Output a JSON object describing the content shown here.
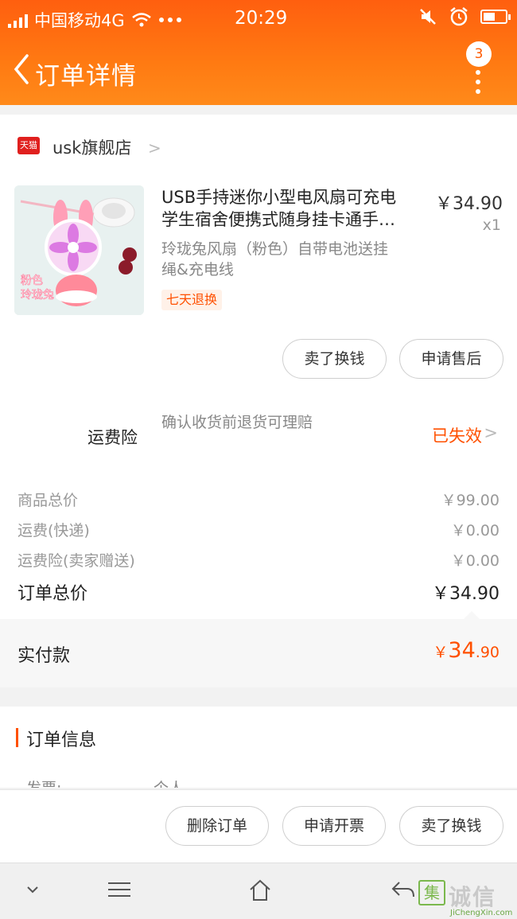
{
  "status_bar": {
    "carrier": "中国移动4G",
    "time": "20:29"
  },
  "nav": {
    "title": "订单详情",
    "badge_count": "3"
  },
  "shop": {
    "logo_text": "天猫",
    "name": "usk旗舰店"
  },
  "product": {
    "title_line1": "USB手持迷你小型电风扇可充电",
    "title_line2": "学生宿舍便携式随身挂卡通手…",
    "sku_line1": "玲珑兔风扇（粉色）自带电池送挂",
    "sku_line2": "绳&充电线",
    "tag": "七天退换",
    "price": "￥34.90",
    "qty": "x1",
    "image_caption": "粉色 玲珑兔"
  },
  "item_actions": {
    "sell": "卖了换钱",
    "aftersale": "申请售后"
  },
  "insurance": {
    "label": "运费险",
    "desc": "确认收货前退货可理赔",
    "status": "已失效"
  },
  "fees": [
    {
      "label": "商品总价",
      "value": "￥99.00"
    },
    {
      "label": "运费(快递)",
      "value": "￥0.00"
    },
    {
      "label": "运费险(卖家赠送)",
      "value": "￥0.00"
    }
  ],
  "total": {
    "label": "订单总价",
    "value": "￥34.90"
  },
  "paid": {
    "label": "实付款",
    "currency": "￥",
    "int": "34",
    "dec": ".90"
  },
  "order_info": {
    "title": "订单信息",
    "invoice_label": "发票:",
    "invoice_value": "个人"
  },
  "bottom_actions": {
    "delete": "删除订单",
    "invoice": "申请开票",
    "sell": "卖了换钱"
  },
  "watermark": {
    "logo": "集",
    "text": "诚信",
    "sub": "JiChengXin.com"
  }
}
